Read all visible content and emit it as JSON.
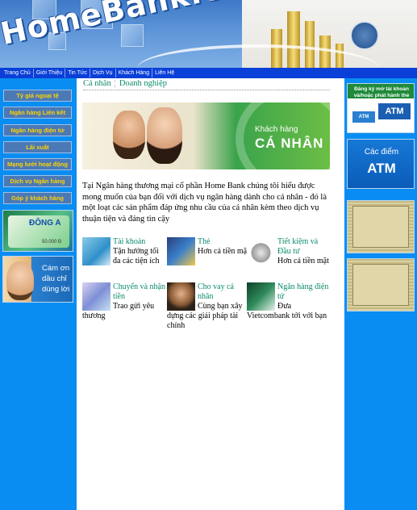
{
  "banner": {
    "logo_text": "HomeBank.com"
  },
  "nav": {
    "items": [
      "Trang Chủ",
      "Giới Thiệu",
      "Tin Tức",
      "Dịch Vụ",
      "Khách Hàng",
      "Liên Hệ"
    ]
  },
  "left_menu": {
    "items": [
      "Tỷ giá ngoại tệ",
      "Ngân hàng Liên kết",
      "Ngân hàng điện tử",
      "Lãi xuất",
      "Mạng lưới hoạt động",
      "Dịch vụ Ngân hàng",
      "Góp ý khách hàng"
    ]
  },
  "left_promos": {
    "card_brand": "ĐÔNG A",
    "card_value": "50.000 Đ",
    "promo_text": "Cám ơn dầu chỉ dùng lời"
  },
  "right_banners": {
    "account_text": "Đăng ký mở tài khoản và/hoặc phát hành thẻ",
    "atm_big": "ATM",
    "atm_small": "ATM",
    "atm_points_line1": "Các điểm",
    "atm_points_line2": "ATM"
  },
  "main": {
    "tabs": [
      "Cá nhân",
      "Doanh nghiệp"
    ],
    "hero": {
      "line1": "Khách hàng",
      "line2": "CÁ NHÂN"
    },
    "intro": "Tại Ngân hàng thương mại cổ phần Home Bank chúng tôi hiểu được mong muốn của bạn đối với dịch vụ ngân hàng dành cho cá nhân - đó là một loạt các sản phẩm đáp ứng nhu cầu của cá nhân kèm theo dịch vụ thuận tiện và đáng tin cậy",
    "services": [
      {
        "title": "Tài khoản",
        "desc": "Tận hưởng tối đa các tiện ích",
        "icon": "account-icon"
      },
      {
        "title": "Thẻ",
        "desc": "Hơn cả tiền mặt",
        "icon": "card-icon"
      },
      {
        "title": "Tiết kiệm và Đầu tư",
        "desc": "Hơn cả tiền mặt",
        "icon": "savings-icon"
      },
      {
        "title": "Chuyển và nhận tiền",
        "desc": "Trao gửi yêu thương",
        "icon": "transfer-icon"
      },
      {
        "title": "Cho vay cá nhân",
        "desc": "Cùng bạn xây dựng các giải pháp tài chính",
        "icon": "loan-icon"
      },
      {
        "title": "Ngân hàng điện tử",
        "desc": "Đưa Vietcombank tới với bạn",
        "icon": "ebanking-icon"
      }
    ]
  }
}
